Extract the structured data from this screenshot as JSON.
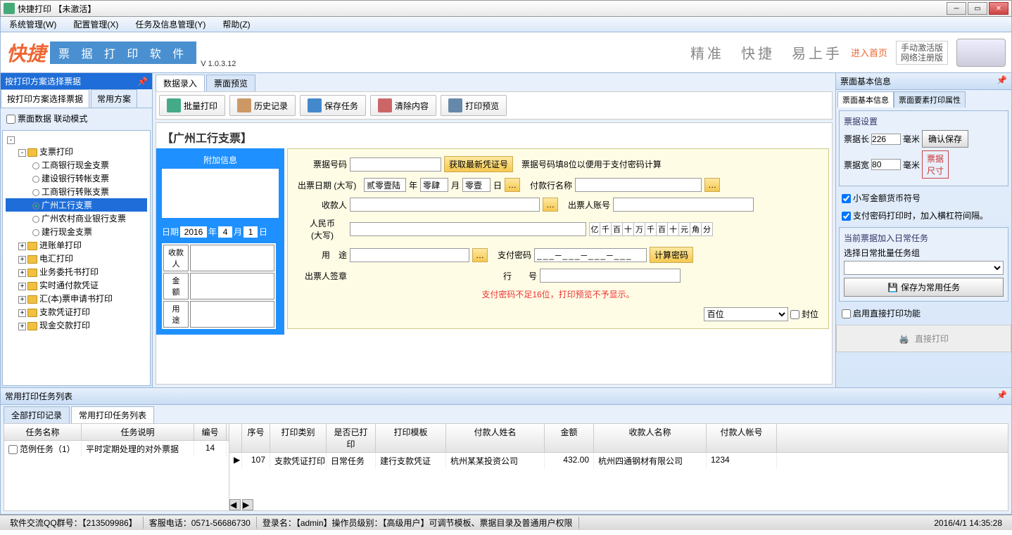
{
  "window": {
    "title": "快捷打印 【未激活】"
  },
  "menu": {
    "sys": "系统管理(W)",
    "cfg": "配置管理(X)",
    "task": "任务及信息管理(Y)",
    "help": "帮助(Z)"
  },
  "brand": {
    "logo": "快捷",
    "sub": "票 据 打 印 软 件",
    "ver": "V 1.0.3.12",
    "slogan": "精准　快捷　易上手",
    "enter": "进入首页",
    "act1": "手动激活版",
    "act2": "网络注册版"
  },
  "sidebar": {
    "header": "按打印方案选择票据",
    "tab1": "按打印方案选择票据",
    "tab2": "常用方案",
    "linkcheck": "票面数据 联动模式",
    "tree": {
      "root": "支票打印",
      "n1": "工商银行现金支票",
      "n2": "建设银行转帐支票",
      "n3": "工商银行转账支票",
      "n4": "广州工行支票",
      "n5": "广州农村商业银行支票",
      "n6": "建行现金支票",
      "g2": "进账单打印",
      "g3": "电汇打印",
      "g4": "业务委托书打印",
      "g5": "实时通付款凭证",
      "g6": "汇(本)票申请书打印",
      "g7": "支款凭证打印",
      "g8": "现金交款打印"
    }
  },
  "center": {
    "tab1": "数据录入",
    "tab2": "票面预览",
    "toolbar": {
      "batch": "批量打印",
      "hist": "历史记录",
      "save": "保存任务",
      "clear": "清除内容",
      "prev": "打印预览"
    },
    "title": "【广州工行支票】",
    "extra": {
      "title": "附加信息",
      "date": "日期",
      "year_v": "2016",
      "year": "年",
      "month_v": "4",
      "month": "月",
      "day_v": "1",
      "day": "日",
      "payee": "收款人",
      "amount": "金　额",
      "usage": "用　途"
    },
    "form": {
      "billno": "票据号码",
      "getno": "获取最新凭证号",
      "billno_hint": "票据号码填8位以便用于支付密码计算",
      "issue": "出票日期 (大写)",
      "y_v": "贰零壹陆",
      "y": "年",
      "m_v": "零肆",
      "m": "月",
      "d_v": "零壹",
      "d": "日",
      "paybank": "付款行名称",
      "payee": "收款人",
      "drawer_acc": "出票人账号",
      "rmb": "人民币\n(大写)",
      "units": [
        "亿",
        "千",
        "百",
        "十",
        "万",
        "千",
        "百",
        "十",
        "元",
        "角",
        "分"
      ],
      "usage": "用　途",
      "paypwd": "支付密码",
      "pwd_tpl": "___─___─___─___",
      "calcpwd": "计算密码",
      "sig": "出票人签章",
      "bankno": "行　　号",
      "warn": "支付密码不足16位，打印预览不予显示。",
      "digit_sel": "百位",
      "seal": "封位"
    }
  },
  "right": {
    "header": "票面基本信息",
    "tab1": "票面基本信息",
    "tab2": "票面要素打印属性",
    "g1": "票据设置",
    "len": "票据长",
    "len_v": "226",
    "wid": "票据宽",
    "wid_v": "80",
    "mm": "毫米",
    "savebtn": "确认保存",
    "sizebtn": "票据\n尺寸",
    "ck1": "小写金额货币符号",
    "ck2": "支付密码打印时，加入横杠符间隔。",
    "g2": "当前票据加入日常任务",
    "sel_lbl": "选择日常批量任务组",
    "savetask": "保存为常用任务",
    "ck3": "启用直接打印功能",
    "direct": "直接打印"
  },
  "tasklist": {
    "header": "常用打印任务列表",
    "tab1": "全部打印记录",
    "tab2": "常用打印任务列表",
    "lh": {
      "c1": "任务名称",
      "c2": "任务说明",
      "c3": "编号"
    },
    "lr": {
      "c1": "范例任务（1）",
      "c2": "平时定期处理的对外票据",
      "c3": "14"
    },
    "rh": {
      "c1": "序号",
      "c2": "打印类别",
      "c3": "是否已打印",
      "c4": "打印模板",
      "c5": "付款人姓名",
      "c6": "金额",
      "c7": "收款人名称",
      "c8": "付款人帐号"
    },
    "rr": {
      "c1": "107",
      "c2": "支款凭证打印",
      "c3": "日常任务",
      "c4": "建行支款凭证",
      "c5": "杭州某某投资公司",
      "c6": "432.00",
      "c7": "杭州四通钢材有限公司",
      "c8": "1234"
    }
  },
  "status": {
    "qq": "软件交流QQ群号：【213509986】",
    "tel": "客服电话：0571-56686730",
    "login": "登录名：【admin】操作员级别：【高级用户】可调节模板、票据目录及普通用户权限",
    "time": "2016/4/1 14:35:28"
  }
}
